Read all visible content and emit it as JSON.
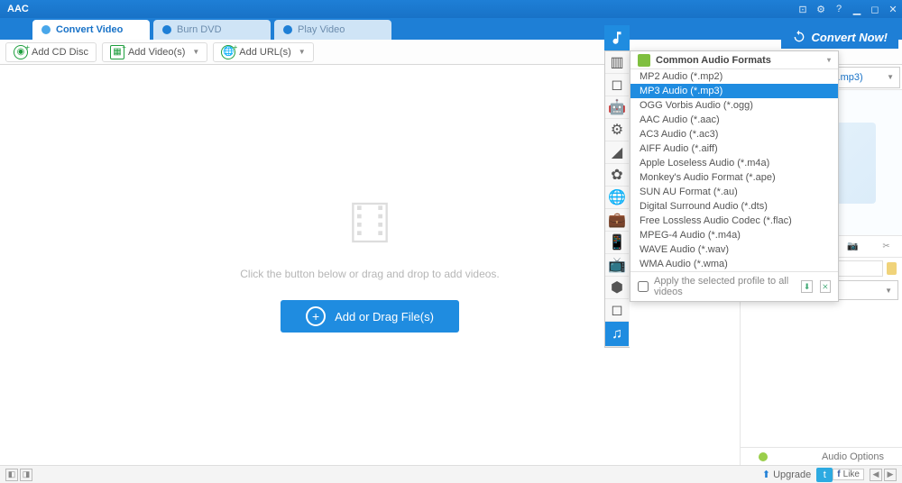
{
  "title": "AAC",
  "tabs": [
    {
      "label": "Convert Video",
      "active": true
    },
    {
      "label": "Burn DVD",
      "active": false
    },
    {
      "label": "Play Video",
      "active": false
    }
  ],
  "toolbar": {
    "add_cd": "Add CD Disc",
    "add_videos": "Add Video(s)",
    "add_urls": "Add URL(s)"
  },
  "drop": {
    "hint": "Click the button below or drag and drop to add videos.",
    "button": "Add or Drag File(s)"
  },
  "format_select": "MP3 Audio (*.mp3)",
  "convert_label": "Convert Now!",
  "dest_path": "AAC\\MP3",
  "audio_options": "Audio Options",
  "upgrade": "Upgrade",
  "like": "Like",
  "profile": {
    "header": "Common Audio Formats",
    "selected_index": 1,
    "items": [
      "MP2 Audio (*.mp2)",
      "MP3 Audio (*.mp3)",
      "OGG Vorbis Audio (*.ogg)",
      "AAC Audio (*.aac)",
      "AC3 Audio (*.ac3)",
      "AIFF Audio (*.aiff)",
      "Apple Loseless Audio (*.m4a)",
      "Monkey's Audio Format (*.ape)",
      "SUN AU Format (*.au)",
      "Digital Surround Audio (*.dts)",
      "Free Lossless Audio Codec (*.flac)",
      "MPEG-4 Audio (*.m4a)",
      "WAVE Audio (*.wav)",
      "WMA Audio (*.wma)"
    ],
    "footer": "Apply the selected profile to all videos"
  },
  "categories": [
    "chart-icon",
    "apple-icon",
    "android-icon",
    "android2-icon",
    "playstation-icon",
    "flower-icon",
    "globe-icon",
    "briefcase-icon",
    "phone-icon",
    "tv-icon",
    "html5-icon",
    "blank-icon",
    "music-icon"
  ]
}
